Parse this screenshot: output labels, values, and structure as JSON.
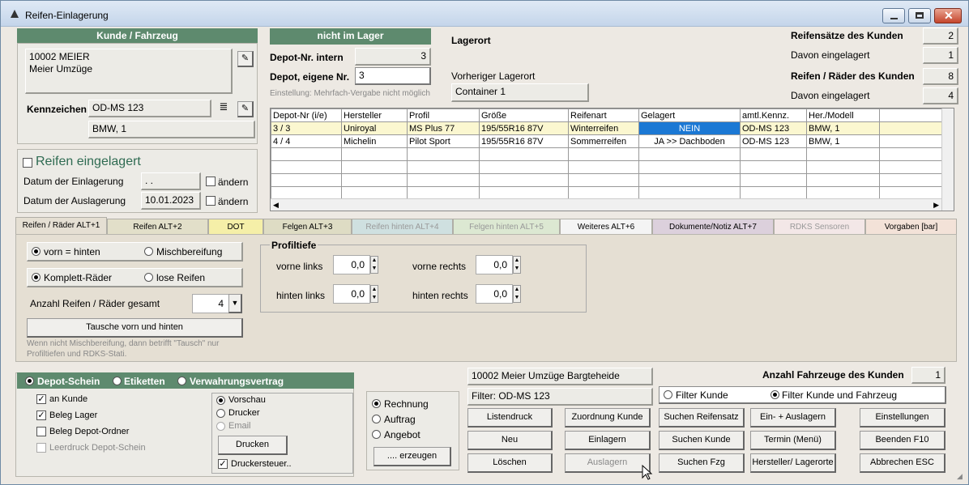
{
  "window": {
    "title": "Reifen-Einlagerung"
  },
  "kunde": {
    "header": "Kunde / Fahrzeug",
    "line1": "10002 MEIER",
    "line2": "Meier Umzüge",
    "kennzeichen_label": "Kennzeichen",
    "kennzeichen": "OD-MS 123",
    "fahrzeug": "BMW, 1"
  },
  "einlagerung": {
    "title": "Reifen eingelagert",
    "datum_ein_label": "Datum der Einlagerung",
    "datum_ein": " . .",
    "datum_aus_label": "Datum der Auslagerung",
    "datum_aus": "10.01.2023",
    "aendern1": "ändern",
    "aendern2": "ändern"
  },
  "lager": {
    "status": "nicht im Lager",
    "lagerort_label": "Lagerort",
    "depot_intern_label": "Depot-Nr. intern",
    "depot_intern": "3",
    "depot_eigene_label": "Depot, eigene Nr.",
    "depot_eigene": "3",
    "einstellung": "Einstellung: Mehrfach-Vergabe nicht möglich",
    "vorheriger_label": "Vorheriger Lagerort",
    "vorheriger": "Container 1"
  },
  "stats": {
    "reifensaetze_label": "Reifensätze des Kunden",
    "reifensaetze": "2",
    "davon1_label": "Davon eingelagert",
    "davon1": "1",
    "reifen_label": "Reifen / Räder des Kunden",
    "reifen": "8",
    "davon2_label": "Davon eingelagert",
    "davon2": "4"
  },
  "table": {
    "headers": [
      "Depot-Nr (i/e)",
      "Hersteller",
      "Profil",
      "Größe",
      "Reifenart",
      "Gelagert",
      "amtl.Kennz.",
      "Her./Modell"
    ],
    "rows": [
      [
        "3 / 3",
        "Uniroyal",
        "MS Plus 77",
        "195/55R16 87V",
        "Winterreifen",
        "NEIN",
        "OD-MS 123",
        "BMW, 1"
      ],
      [
        "4 / 4",
        "Michelin",
        "Pilot Sport",
        "195/55R16 87V",
        "Sommerreifen",
        "JA >> Dachboden",
        "OD-MS 123",
        "BMW, 1"
      ]
    ]
  },
  "tabs": [
    "Reifen / Räder ALT+1",
    "Reifen ALT+2",
    "DOT",
    "Felgen ALT+3",
    "Reifen hinten ALT+4",
    "Felgen hinten ALT+5",
    "Weiteres ALT+6",
    "Dokumente/Notiz ALT+7",
    "RDKS Sensoren",
    "Vorgaben [bar]"
  ],
  "reifen_tab": {
    "vorn_hinten": "vorn = hinten",
    "misch": "Mischbereifung",
    "komplett": "Komplett-Räder",
    "lose": "lose Reifen",
    "anzahl_label": "Anzahl Reifen / Räder gesamt",
    "anzahl": "4",
    "tausch_btn": "Tausche vorn und hinten",
    "hinweis1": "Wenn nicht Mischbereifung, dann betrifft \"Tausch\" nur",
    "hinweis2": "Profiltiefen und RDKS-Stati."
  },
  "profil": {
    "title": "Profiltiefe",
    "vl_label": "vorne links",
    "vl": "0,0",
    "vr_label": "vorne rechts",
    "vr": "0,0",
    "hl_label": "hinten links",
    "hl": "0,0",
    "hr_label": "hinten rechts",
    "hr": "0,0"
  },
  "druck": {
    "depot_schein": "Depot-Schein",
    "etiketten": "Etiketten",
    "verwahrung": "Verwahrungsvertrag",
    "an_kunde": "an Kunde",
    "beleg_lager": "Beleg Lager",
    "beleg_ordner": "Beleg Depot-Ordner",
    "leerdruck": "Leerdruck Depot-Schein",
    "vorschau": "Vorschau",
    "drucker": "Drucker",
    "email": "Email",
    "drucken_btn": "Drucken",
    "druckersteuer": "Druckersteuer.."
  },
  "beleg": {
    "rechnung": "Rechnung",
    "auftrag": "Auftrag",
    "angebot": "Angebot",
    "erzeugen_btn": ".... erzeugen"
  },
  "filter": {
    "kunde_text": "10002 Meier Umzüge Bargteheide",
    "filter_text": "Filter: OD-MS 123",
    "anzahl_label": "Anzahl Fahrzeuge des Kunden",
    "anzahl": "1",
    "filter_kunde": "Filter Kunde",
    "filter_kf": "Filter Kunde und Fahrzeug"
  },
  "buttons": {
    "listendruck": "Listendruck",
    "zuordnung": "Zuordnung Kunde",
    "suchen_reifensatz": "Suchen Reifensatz",
    "ein_aus": "Ein- + Auslagern",
    "einstellungen": "Einstellungen",
    "neu": "Neu",
    "einlagern": "Einlagern",
    "suchen_kunde": "Suchen Kunde",
    "termin": "Termin (Menü)",
    "beenden": "Beenden F10",
    "loeschen": "Löschen",
    "auslagern": "Auslagern",
    "suchen_fzg": "Suchen Fzg",
    "hersteller": "Hersteller/ Lagerorte",
    "abbrechen": "Abbrechen ESC"
  }
}
